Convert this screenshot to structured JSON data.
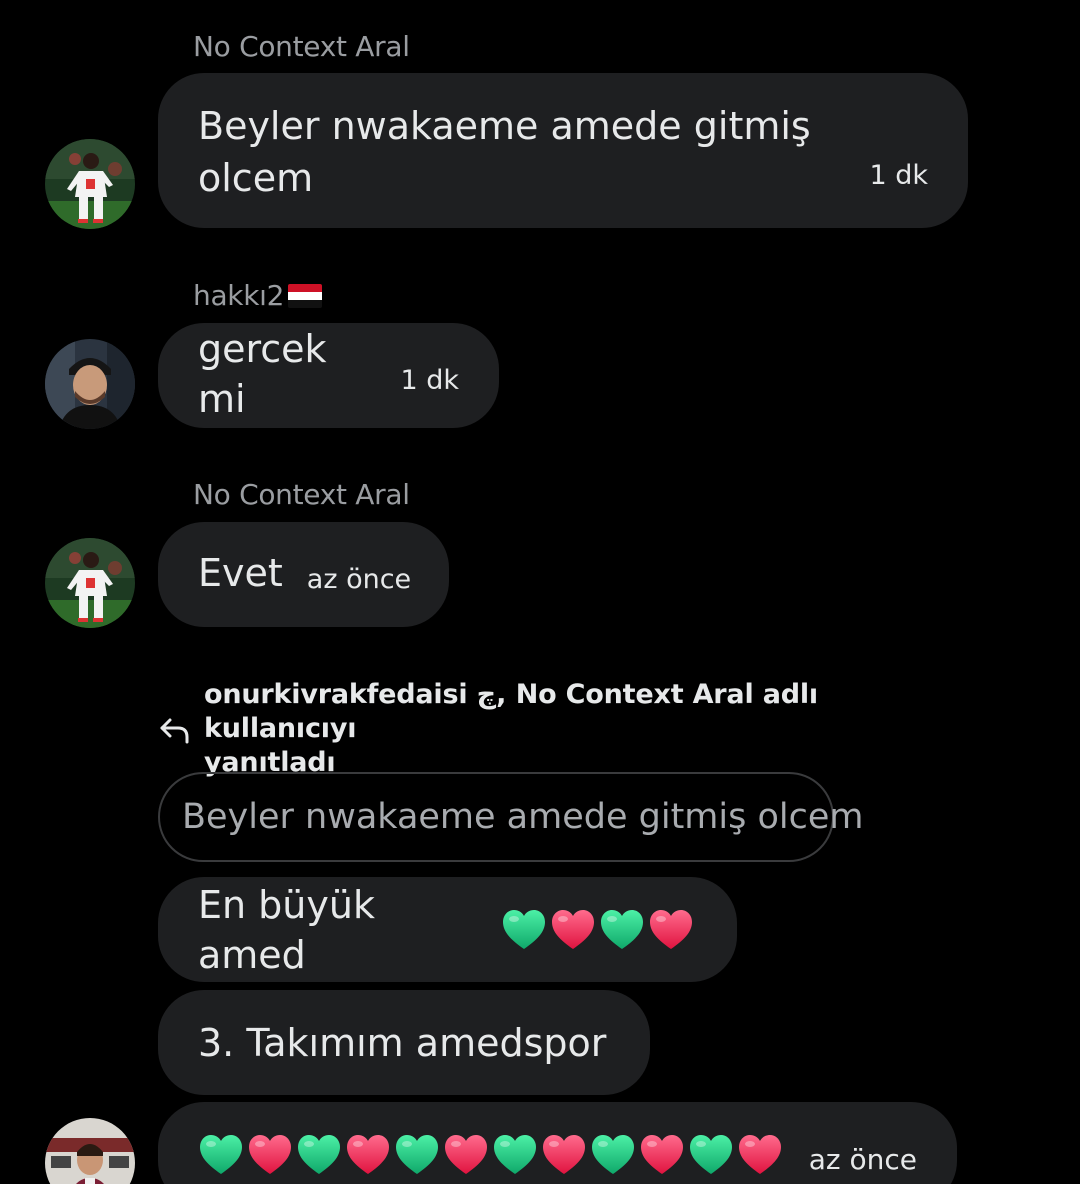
{
  "messages": [
    {
      "sender": "No Context Aral",
      "text": "Beyler nwakaeme amede gitmiş olcem",
      "text_line1": "Beyler nwakaeme amede gitmiş",
      "text_line2": "olcem",
      "time": "1 dk"
    },
    {
      "sender": "hakkı2",
      "sender_flag": "egypt-flag",
      "text": "gercek mi",
      "time": "1 dk"
    },
    {
      "sender": "No Context Aral",
      "text": "Evet",
      "time": "az önce"
    }
  ],
  "reply": {
    "icon": "reply-arrow-icon",
    "text": "onurkivrakfedaisi ﭺ, No Context Aral adlı kullanıcıyı yanıtladı",
    "line1": "onurkivrakfedaisi ﭺ, No Context Aral adlı kullanıcıyı",
    "line2": "yanıtladı",
    "quoted": "Beyler nwakaeme amede gitmiş olcem"
  },
  "reply_messages": [
    {
      "text": "En büyük amed",
      "emojis": [
        "green-heart",
        "red-heart",
        "green-heart",
        "red-heart"
      ]
    },
    {
      "text": "3. Takımım amedspor"
    },
    {
      "emojis": [
        "green-heart",
        "red-heart",
        "green-heart",
        "red-heart",
        "green-heart",
        "red-heart",
        "green-heart",
        "red-heart",
        "green-heart",
        "red-heart",
        "green-heart",
        "red-heart"
      ],
      "time": "az önce"
    }
  ],
  "colors": {
    "background": "#000000",
    "bubble": "#1e1f21",
    "green_heart": "#1fcf7f",
    "red_heart": "#ff2f5f"
  }
}
